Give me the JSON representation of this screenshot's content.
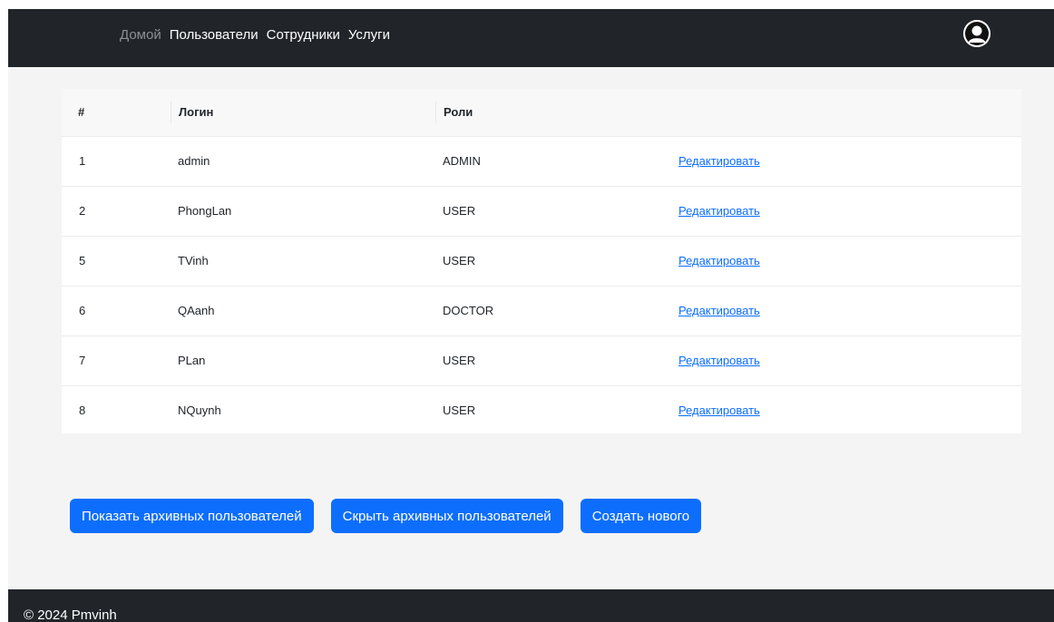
{
  "nav": {
    "home": "Домой",
    "users": "Пользователи",
    "employees": "Сотрудники",
    "services": "Услуги"
  },
  "table": {
    "headers": [
      "#",
      "Логин",
      "Роли",
      ""
    ],
    "rows": [
      {
        "id": "1",
        "login": "admin",
        "role": "ADMIN",
        "action": "Редактировать"
      },
      {
        "id": "2",
        "login": "PhongLan",
        "role": "USER",
        "action": "Редактировать"
      },
      {
        "id": "5",
        "login": "TVinh",
        "role": "USER",
        "action": "Редактировать"
      },
      {
        "id": "6",
        "login": "QAanh",
        "role": "DOCTOR",
        "action": "Редактировать"
      },
      {
        "id": "7",
        "login": "PLan",
        "role": "USER",
        "action": "Редактировать"
      },
      {
        "id": "8",
        "login": "NQuynh",
        "role": "USER",
        "action": "Редактировать"
      }
    ]
  },
  "buttons": {
    "show_archived": "Показать архивных пользователей",
    "hide_archived": "Скрыть архивных пользователей",
    "create_new": "Создать нового"
  },
  "footer": {
    "text": "© 2024 Pmvinh"
  },
  "icons": {
    "avatar": "user-avatar-icon"
  },
  "colors": {
    "navbar": "#212529",
    "primary": "#0d6efd",
    "background": "#f4f4f4"
  }
}
